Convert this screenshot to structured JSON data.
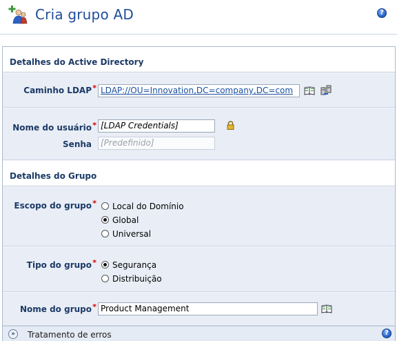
{
  "header": {
    "title": "Cria grupo AD",
    "help_icon": "help-icon",
    "app_icon": "group-add-icon"
  },
  "sections": {
    "ad_details": {
      "title": "Detalhes do Active Directory"
    },
    "group_details": {
      "title": "Detalhes do Grupo"
    }
  },
  "ldap": {
    "label": "Caminho LDAP",
    "value": "LDAP://OU=Innovation,DC=company,DC=com",
    "browse_icon": "book-icon",
    "server_icon": "server-icon"
  },
  "credentials": {
    "username_label": "Nome do usuário",
    "username_value": "[LDAP Credentials]",
    "lock_icon": "lock-icon",
    "password_label": "Senha",
    "password_value": "[Predefinido]"
  },
  "scope": {
    "label": "Escopo do grupo",
    "options": [
      "Local do Domínio",
      "Global",
      "Universal"
    ],
    "selected": "Global"
  },
  "type": {
    "label": "Tipo do grupo",
    "options": [
      "Segurança",
      "Distribuição"
    ],
    "selected": "Segurança"
  },
  "group_name": {
    "label": "Nome do grupo",
    "value": "Product Management",
    "browse_icon": "book-icon"
  },
  "footer": {
    "label": "Tratamento de erros",
    "required_marker": "*"
  },
  "colors": {
    "title": "#1f4d9a",
    "label": "#1c3a66",
    "required": "#d40000",
    "row_bg": "#e9eef6"
  }
}
